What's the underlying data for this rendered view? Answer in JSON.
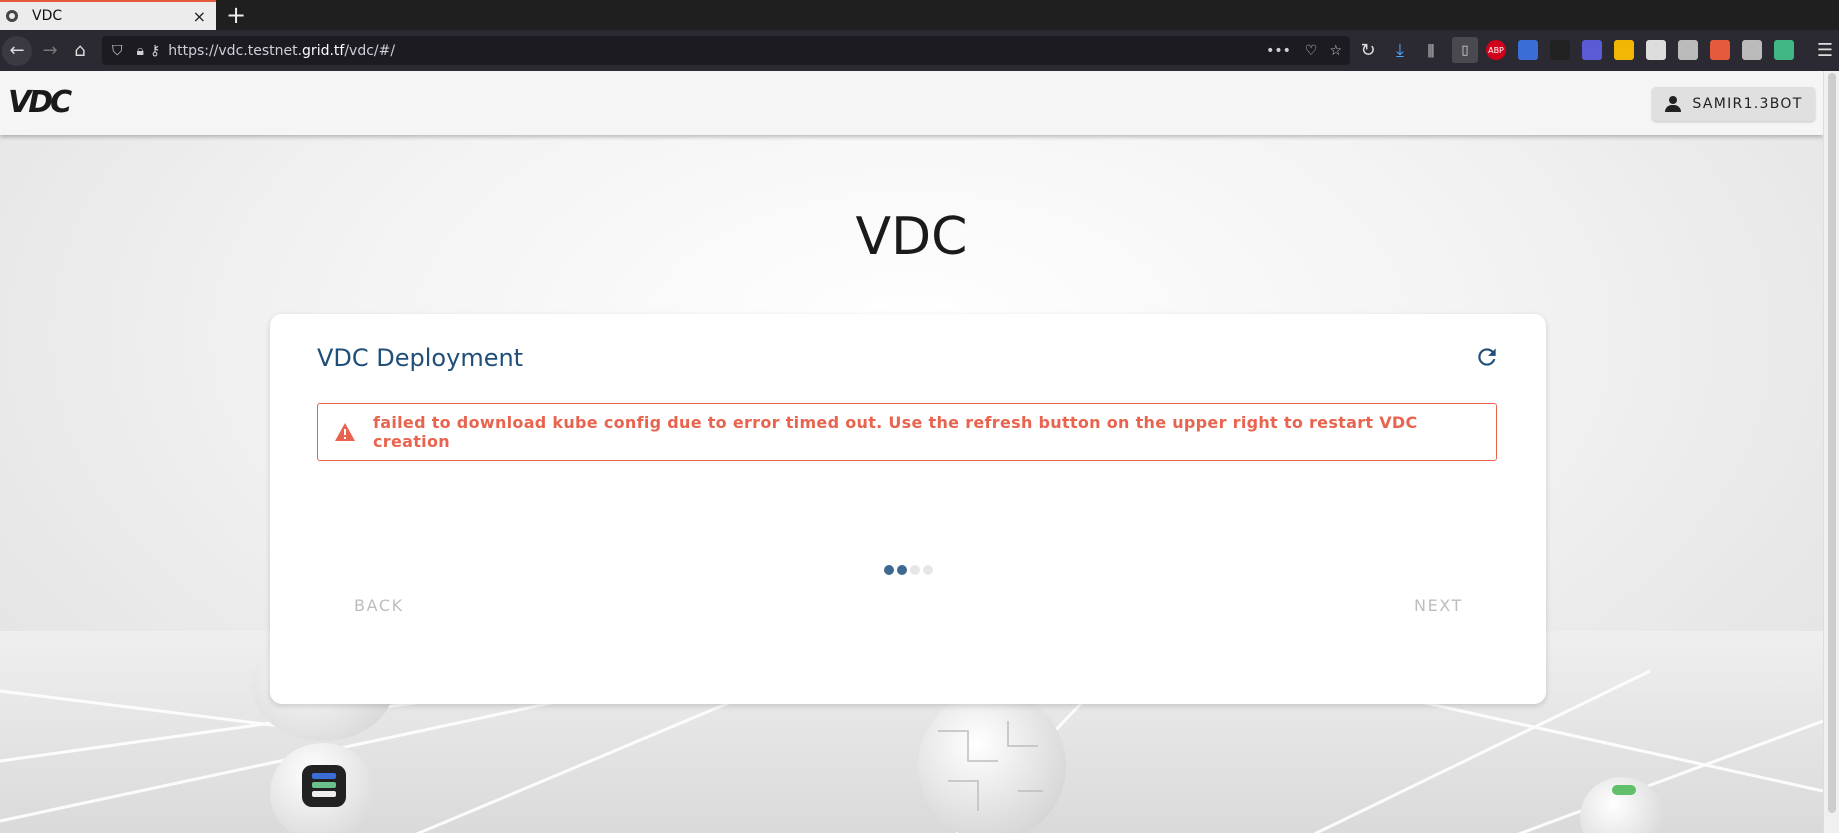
{
  "browser": {
    "tab_title": "VDC",
    "tab_close": "×",
    "new_tab": "+",
    "url_prefix": "https://vdc.testnet.",
    "url_domain": "grid.tf",
    "url_suffix": "/vdc/#/",
    "page_actions": "•••",
    "extensions": [
      {
        "name": "adblock-plus-icon",
        "label": "ABP",
        "color": "#d0021b"
      },
      {
        "name": "clock-icon",
        "label": "",
        "color": "#3a6ed6"
      },
      {
        "name": "gnome-icon",
        "label": "",
        "color": "#222222"
      },
      {
        "name": "meet-icon",
        "label": "",
        "color": "#5b5bd6"
      },
      {
        "name": "keep-icon",
        "label": "",
        "color": "#f2b705"
      },
      {
        "name": "qr-icon",
        "label": "",
        "color": "#dddddd"
      },
      {
        "name": "account-icon",
        "label": "",
        "color": "#bbbbbb"
      },
      {
        "name": "translate-icon",
        "label": "",
        "color": "#e55a3a"
      },
      {
        "name": "reader-icon",
        "label": "",
        "color": "#bbbbbb"
      },
      {
        "name": "vue-icon",
        "label": "",
        "color": "#41b883"
      }
    ]
  },
  "app": {
    "logo_text": "VDC",
    "user_button": "SAMIR1.3BOT",
    "page_heading": "VDC"
  },
  "card": {
    "title": "VDC Deployment",
    "error_message": "failed to download kube config due to error timed out. Use the refresh button on the upper right to restart VDC creation",
    "back_label": "BACK",
    "next_label": "NEXT",
    "stepper": {
      "total": 4,
      "active": 2
    }
  },
  "colors": {
    "accent": "#1f4e79",
    "error": "#e8644f",
    "disabled": "#bdbdbd"
  }
}
